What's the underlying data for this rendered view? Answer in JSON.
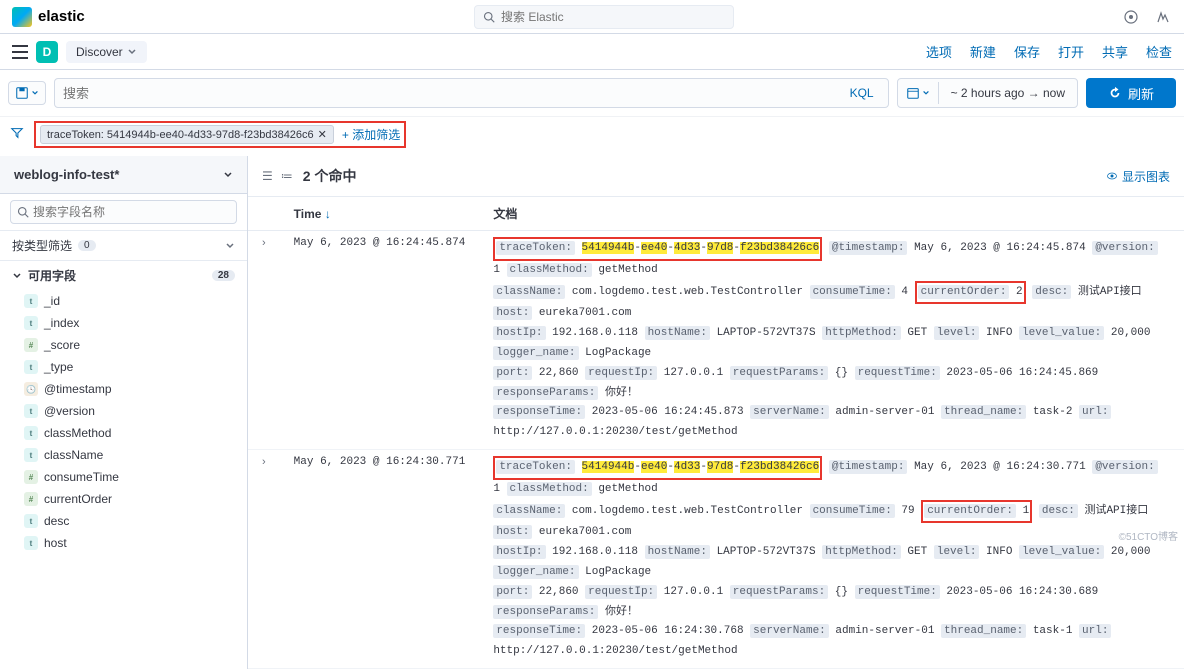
{
  "header": {
    "logo_text": "elastic",
    "search_placeholder": "搜索 Elastic"
  },
  "subheader": {
    "space": "D",
    "app": "Discover",
    "nav": {
      "options": "选项",
      "new": "新建",
      "save": "保存",
      "open": "打开",
      "share": "共享",
      "inspect": "检查"
    }
  },
  "querybar": {
    "placeholder": "搜索",
    "kql": "KQL",
    "time_range": "~ 2 hours ago   →   now",
    "refresh": "刷新"
  },
  "filterbar": {
    "pill": "traceToken: 5414944b-ee40-4d33-97d8-f23bd38426c6",
    "add_filter": "+ 添加筛选"
  },
  "sidebar": {
    "index": "weblog-info-test*",
    "field_search_placeholder": "搜索字段名称",
    "filter_type_label": "按类型筛选",
    "filter_type_count": "0",
    "available_label": "可用字段",
    "available_count": "28",
    "fields": [
      {
        "type": "t",
        "name": "_id"
      },
      {
        "type": "t",
        "name": "_index"
      },
      {
        "type": "hash",
        "name": "_score"
      },
      {
        "type": "t",
        "name": "_type"
      },
      {
        "type": "clock",
        "name": "@timestamp"
      },
      {
        "type": "t",
        "name": "@version"
      },
      {
        "type": "t",
        "name": "classMethod"
      },
      {
        "type": "t",
        "name": "className"
      },
      {
        "type": "hash",
        "name": "consumeTime"
      },
      {
        "type": "hash",
        "name": "currentOrder"
      },
      {
        "type": "t",
        "name": "desc"
      },
      {
        "type": "t",
        "name": "host"
      }
    ]
  },
  "results": {
    "hits_label": "个命中",
    "hits_count": "2",
    "chart_link": "显示图表",
    "col_time": "Time",
    "col_doc": "文档",
    "rows": [
      {
        "time": "May 6, 2023 @ 16:24:45.874",
        "traceToken": "5414944b-ee40-4d33-97d8-f23bd38426c6",
        "timestamp": "May 6, 2023 @ 16:24:45.874",
        "version": "1",
        "classMethod": "getMethod",
        "className": "com.logdemo.test.web.TestController",
        "consumeTime": "4",
        "currentOrder": "2",
        "desc": "测试API接口",
        "host": "eureka7001.com",
        "hostIp": "192.168.0.118",
        "hostName": "LAPTOP-572VT37S",
        "httpMethod": "GET",
        "level": "INFO",
        "level_value": "20,000",
        "logger_name": "LogPackage",
        "port": "22,860",
        "requestIp": "127.0.0.1",
        "requestParams": "{}",
        "requestTime": "2023-05-06 16:24:45.869",
        "responseParams": "你好！",
        "responseTime": "2023-05-06 16:24:45.873",
        "serverName": "admin-server-01",
        "thread_name": "task-2",
        "url": "http://127.0.0.1:20230/test/getMethod"
      },
      {
        "time": "May 6, 2023 @ 16:24:30.771",
        "traceToken": "5414944b-ee40-4d33-97d8-f23bd38426c6",
        "timestamp": "May 6, 2023 @ 16:24:30.771",
        "version": "1",
        "classMethod": "getMethod",
        "className": "com.logdemo.test.web.TestController",
        "consumeTime": "79",
        "currentOrder": "1",
        "desc": "测试API接口",
        "host": "eureka7001.com",
        "hostIp": "192.168.0.118",
        "hostName": "LAPTOP-572VT37S",
        "httpMethod": "GET",
        "level": "INFO",
        "level_value": "20,000",
        "logger_name": "LogPackage",
        "port": "22,860",
        "requestIp": "127.0.0.1",
        "requestParams": "{}",
        "requestTime": "2023-05-06 16:24:30.689",
        "responseParams": "你好！",
        "responseTime": "2023-05-06 16:24:30.768",
        "serverName": "admin-server-01",
        "thread_name": "task-1",
        "url": "http://127.0.0.1:20230/test/getMethod"
      }
    ]
  },
  "watermark": "©51CTO博客"
}
